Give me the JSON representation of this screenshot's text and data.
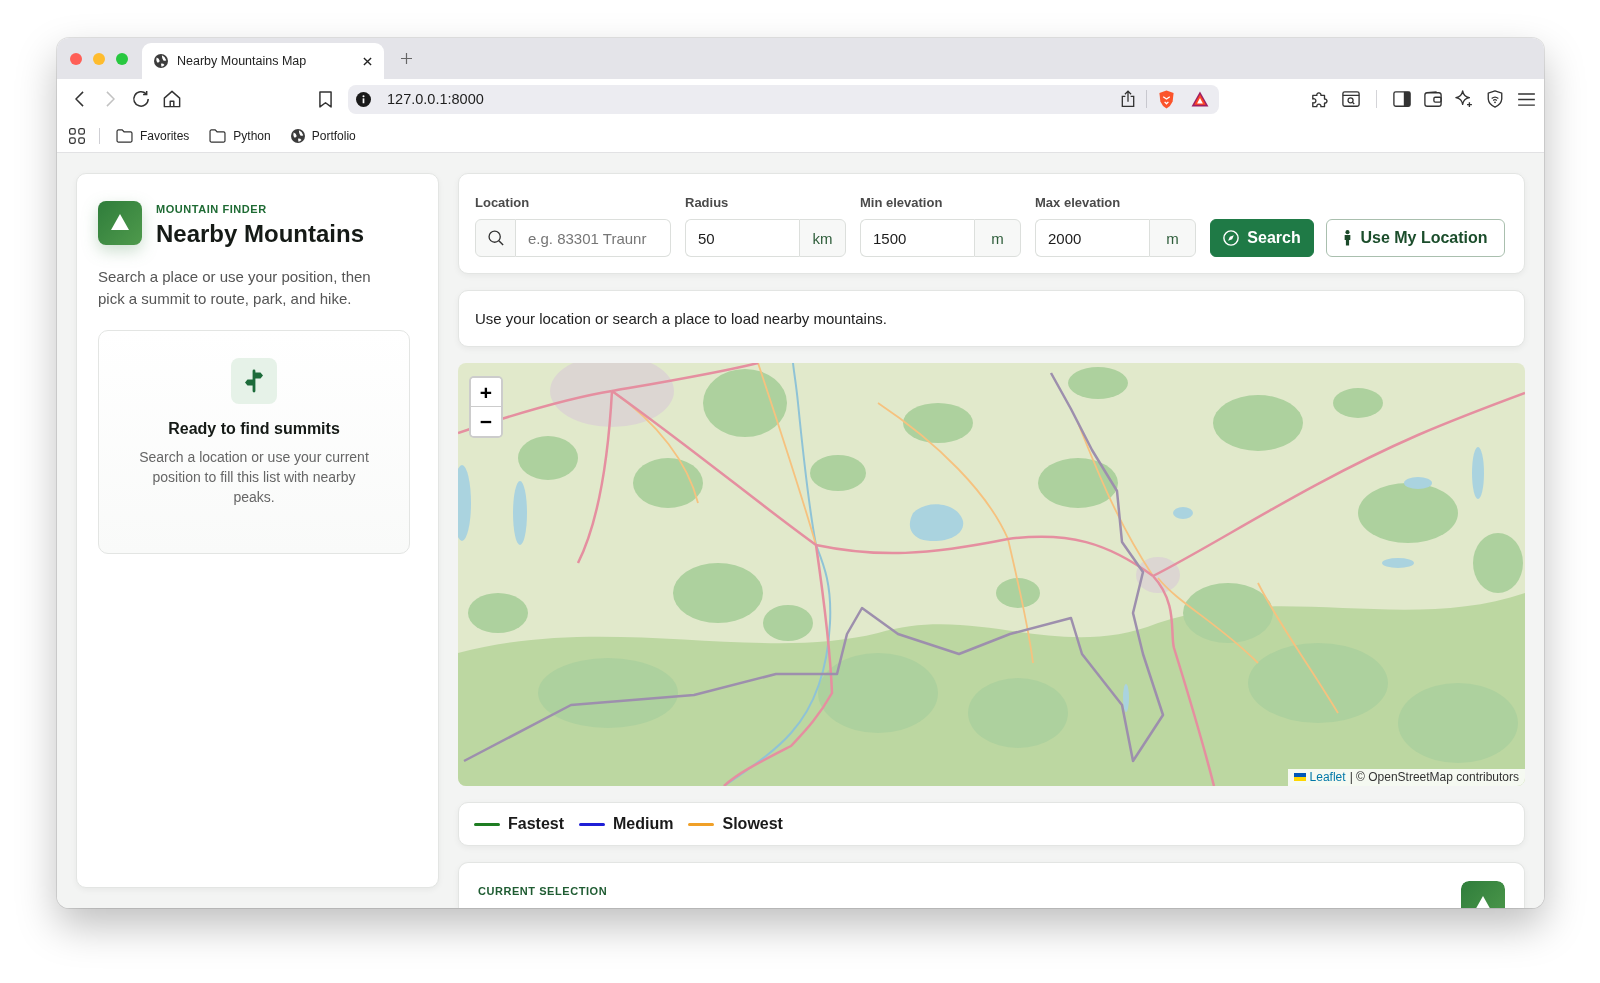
{
  "browser": {
    "tab": {
      "title": "Nearby Mountains Map",
      "selected": true
    },
    "forward_disabled": true,
    "url": "127.0.0.1:8000",
    "bookmarks": [
      {
        "kind": "folder",
        "label": "Favorites"
      },
      {
        "kind": "folder",
        "label": "Python"
      },
      {
        "kind": "site",
        "label": "Portfolio"
      }
    ]
  },
  "sidebar": {
    "eyebrow": "MOUNTAIN FINDER",
    "title": "Nearby Mountains",
    "description": "Search a place or use your position, then pick a summit to route, park, and hike.",
    "empty_state": {
      "title": "Ready to find summits",
      "text": "Search a location or use your current position to fill this list with nearby peaks."
    }
  },
  "search_form": {
    "fields": [
      {
        "kind": "search",
        "label": "Location",
        "placeholder": "e.g. 83301 Traunr"
      },
      {
        "kind": "unit",
        "label": "Radius",
        "value": "50",
        "unit": "km"
      },
      {
        "kind": "unit",
        "label": "Min elevation",
        "value": "1500",
        "unit": "m"
      },
      {
        "kind": "unit",
        "label": "Max elevation",
        "value": "2000",
        "unit": "m"
      }
    ],
    "buttons": [
      {
        "kind": "primary",
        "label": "Search"
      },
      {
        "kind": "secondary",
        "label": "Use My Location"
      }
    ]
  },
  "status_message": "Use your location or search a place to load nearby mountains.",
  "map": {
    "zoom_in": "+",
    "zoom_out": "−",
    "attribution": {
      "link": "Leaflet",
      "text": "| © OpenStreetMap contributors"
    }
  },
  "legend": [
    {
      "label": "Fastest",
      "color": "#1e7d22"
    },
    {
      "label": "Medium",
      "color": "#1f1fd6"
    },
    {
      "label": "Slowest",
      "color": "#f0a028"
    }
  ],
  "selection": {
    "eyebrow": "CURRENT SELECTION"
  }
}
